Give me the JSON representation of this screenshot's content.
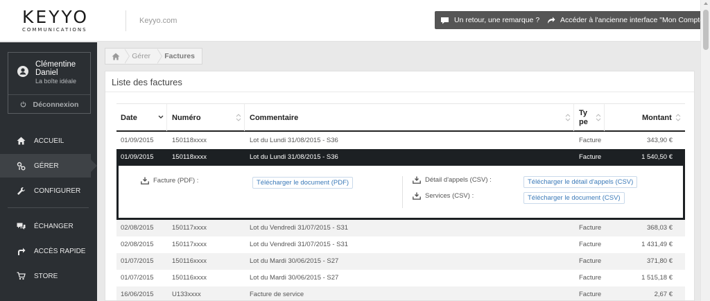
{
  "header": {
    "logo_text": "KEYYO",
    "logo_subtext": "COMMUNICATIONS",
    "site": "Keyyo.com",
    "feedback_button": "Un retour, une remarque ?",
    "old_interface_button": "Accéder à l'ancienne interface \"Mon Compte\""
  },
  "user": {
    "name": "Clémentine Daniel",
    "company": "La boîte idéale",
    "logout": "Déconnexion"
  },
  "nav": {
    "items": [
      {
        "label": "ACCUEIL",
        "icon": "home-icon"
      },
      {
        "label": "GÉRER",
        "icon": "manage-icon"
      },
      {
        "label": "CONFIGURER",
        "icon": "wrench-icon"
      },
      {
        "label": "ÉCHANGER",
        "icon": "chat-icon"
      },
      {
        "label": "ACCÈS RAPIDE",
        "icon": "shortcut-arrow-icon"
      },
      {
        "label": "STORE",
        "icon": "cart-icon"
      }
    ],
    "active": "GÉRER"
  },
  "breadcrumb": {
    "home_icon": "home-icon",
    "items": [
      "Gérer",
      "Factures"
    ]
  },
  "panel": {
    "title": "Liste des factures"
  },
  "table": {
    "columns": [
      "Date",
      "Numéro",
      "Commentaire",
      "Type",
      "Montant"
    ],
    "rows": [
      {
        "date": "01/09/2015",
        "numero": "150118xxxx",
        "commentaire": "Lot du Lundi 31/08/2015 - S36",
        "type": "Facture",
        "montant": "343,90 €"
      },
      {
        "date": "01/09/2015",
        "numero": "150118xxxx",
        "commentaire": "Lot du Lundi 31/08/2015 - S36",
        "type": "Facture",
        "montant": "1 540,50 €"
      },
      {
        "date": "02/08/2015",
        "numero": "150117xxxx",
        "commentaire": "Lot du Vendredi 31/07/2015 - S31",
        "type": "Facture",
        "montant": "368,03 €"
      },
      {
        "date": "02/08/2015",
        "numero": "150117xxxx",
        "commentaire": "Lot du Vendredi 31/07/2015 - S31",
        "type": "Facture",
        "montant": "1 431,49 €"
      },
      {
        "date": "01/07/2015",
        "numero": "150116xxxx",
        "commentaire": "Lot du Mardi 30/06/2015 - S27",
        "type": "Facture",
        "montant": "371,80 €"
      },
      {
        "date": "01/07/2015",
        "numero": "150116xxxx",
        "commentaire": "Lot du Mardi 30/06/2015 - S27",
        "type": "Facture",
        "montant": "1 515,18 €"
      },
      {
        "date": "16/06/2015",
        "numero": "U133xxxx",
        "commentaire": "Facture de service",
        "type": "Facture",
        "montant": "2,67 €"
      }
    ],
    "selected_row": 1
  },
  "detail": {
    "facture_label": "Facture (PDF) :",
    "facture_button": "Télécharger le document (PDF)",
    "appels_label": "Détail d'appels (CSV) :",
    "appels_button": "Télécharger le détail d'appels (CSV)",
    "services_label": "Services (CSV) :",
    "services_button": "Télécharger le document (CSV)"
  },
  "colors": {
    "sidebar_bg": "#2b2f33",
    "sidebar_active": "#3e4246",
    "selected_row": "#1c2023",
    "header_button": "#555555",
    "link": "#3a79b8"
  }
}
